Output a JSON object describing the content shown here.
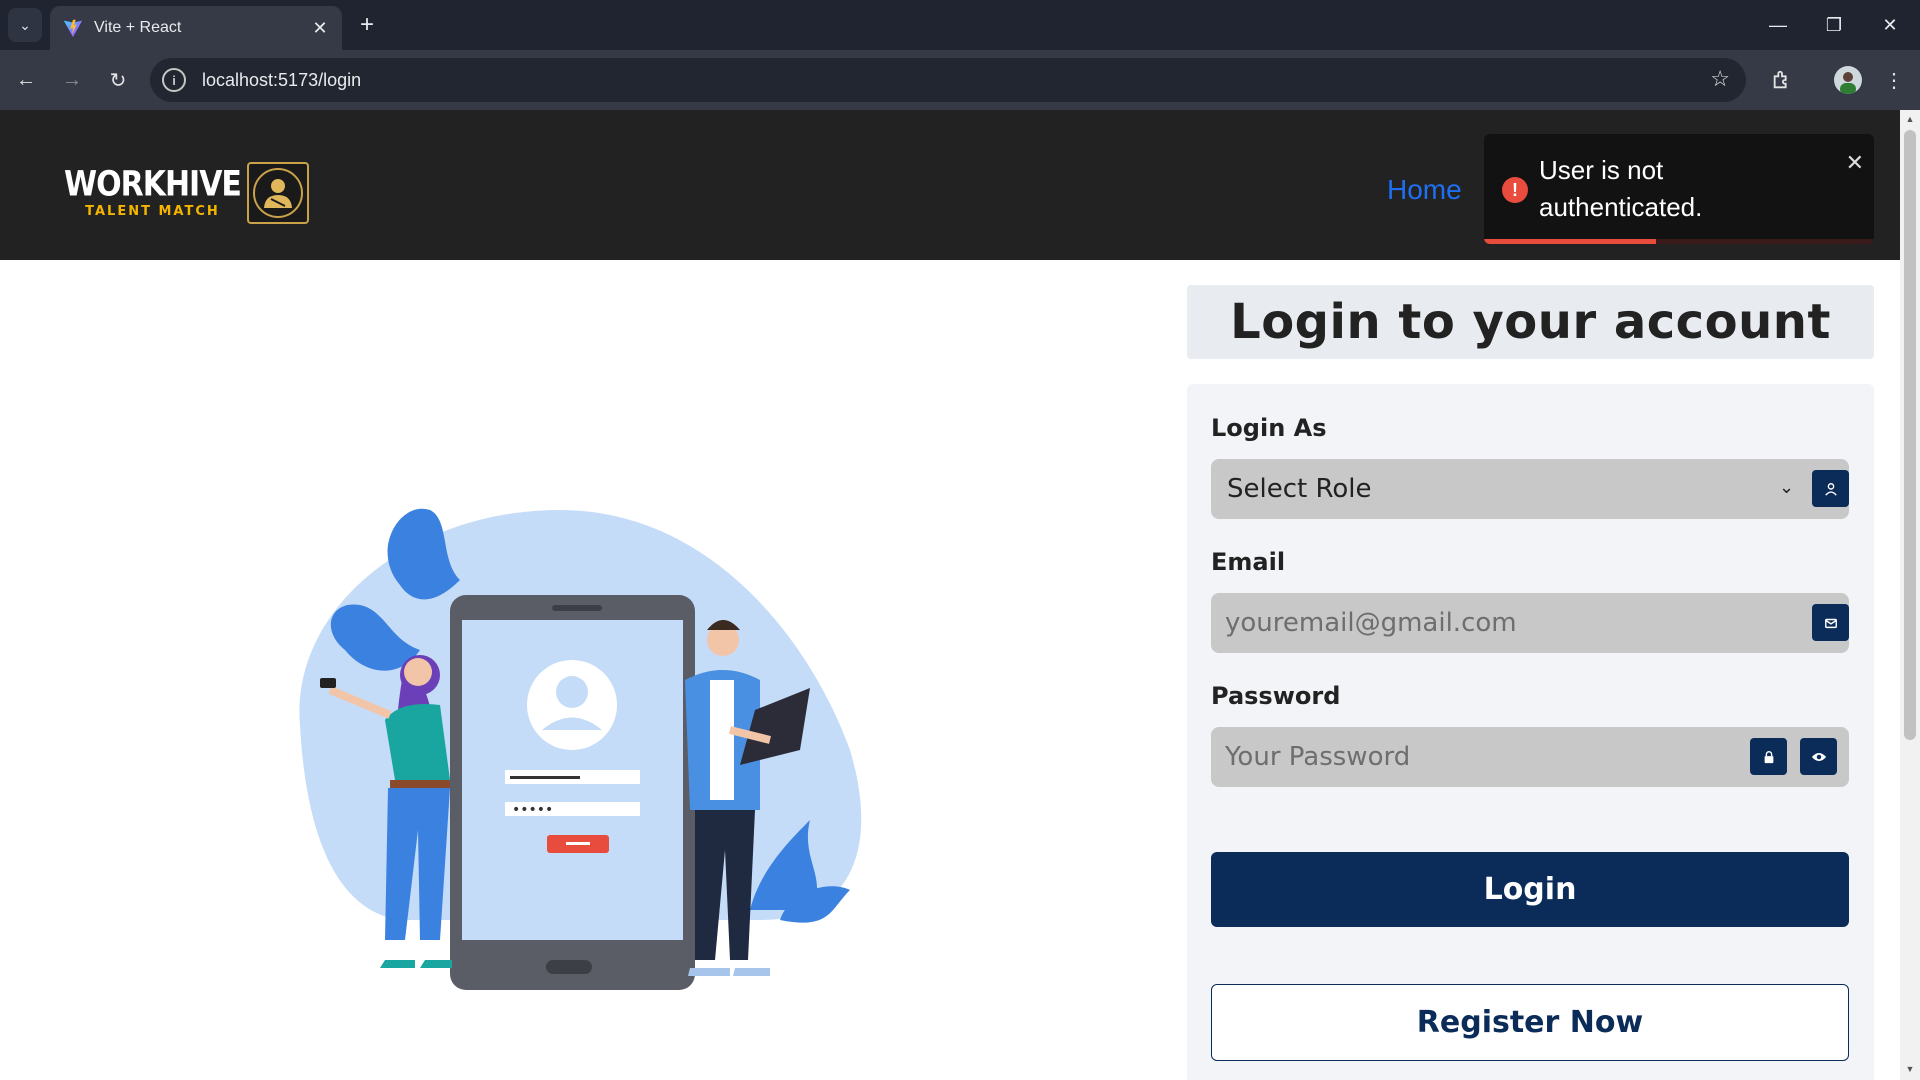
{
  "browser": {
    "tab_title": "Vite + React",
    "url": "localhost:5173/login"
  },
  "navbar": {
    "logo_main": "WORKHIVE",
    "logo_sub": "TALENT MATCH",
    "home_link": "Home"
  },
  "toast": {
    "message": "User is not authenticated.",
    "type": "error",
    "progress": 0.44,
    "color": "#e74c3c"
  },
  "login": {
    "title": "Login to your account",
    "role_label": "Login As",
    "role_placeholder": "Select Role",
    "email_label": "Email",
    "email_placeholder": "youremail@gmail.com",
    "password_label": "Password",
    "password_placeholder": "Your Password",
    "login_button": "Login",
    "register_button": "Register Now"
  },
  "colors": {
    "primary": "#0b2b58",
    "link": "#1e6ff2",
    "navbar_bg": "#222222",
    "accent_gold": "#f4b400"
  }
}
